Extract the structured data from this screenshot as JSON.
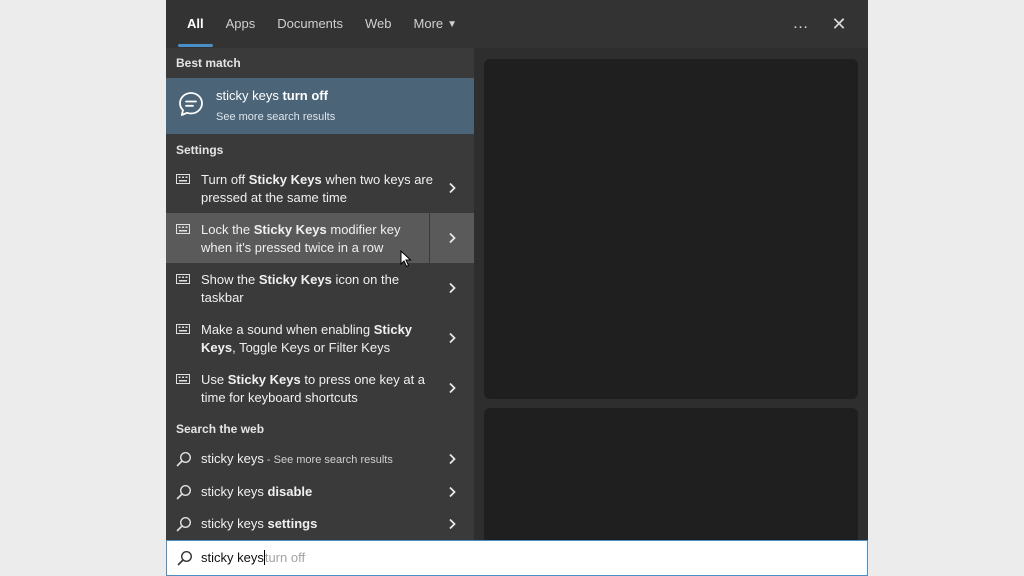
{
  "tabs": [
    {
      "label": "All"
    },
    {
      "label": "Apps"
    },
    {
      "label": "Documents"
    },
    {
      "label": "Web"
    },
    {
      "label": "More"
    }
  ],
  "top_icons": {
    "more_options": "…",
    "close": "✕"
  },
  "sections": {
    "best_match": "Best match",
    "settings": "Settings",
    "search_web": "Search the web"
  },
  "best_match": {
    "title_normal": "sticky keys ",
    "title_bold": "turn off",
    "subtitle": "See more search results",
    "icon": "chat-bubble-icon"
  },
  "settings_items": [
    {
      "p1": "Turn off ",
      "b1": "Sticky Keys",
      "p2": " when two keys are pressed at the same time"
    },
    {
      "p1": "Lock the ",
      "b1": "Sticky Keys",
      "p2": " modifier key when it's pressed twice in a row"
    },
    {
      "p1": "Show the ",
      "b1": "Sticky Keys",
      "p2": " icon on the taskbar"
    },
    {
      "p1": "Make a sound when enabling ",
      "b1": "Sticky Keys",
      "p2": ", Toggle Keys or Filter Keys"
    },
    {
      "p1": "Use ",
      "b1": "Sticky Keys",
      "p2": " to press one key at a time for keyboard shortcuts"
    }
  ],
  "web_items": [
    {
      "normal": "sticky keys",
      "bold": "",
      "small": " - See more search results"
    },
    {
      "normal": "sticky keys ",
      "bold": "disable",
      "small": ""
    },
    {
      "normal": "sticky keys ",
      "bold": "settings",
      "small": ""
    }
  ],
  "search": {
    "typed": "sticky keys",
    "suggestion": "turn off"
  },
  "colors": {
    "accent": "#4a8fc7",
    "best_match_bg": "#4b6477",
    "hover_bg": "#5a5a5a"
  }
}
